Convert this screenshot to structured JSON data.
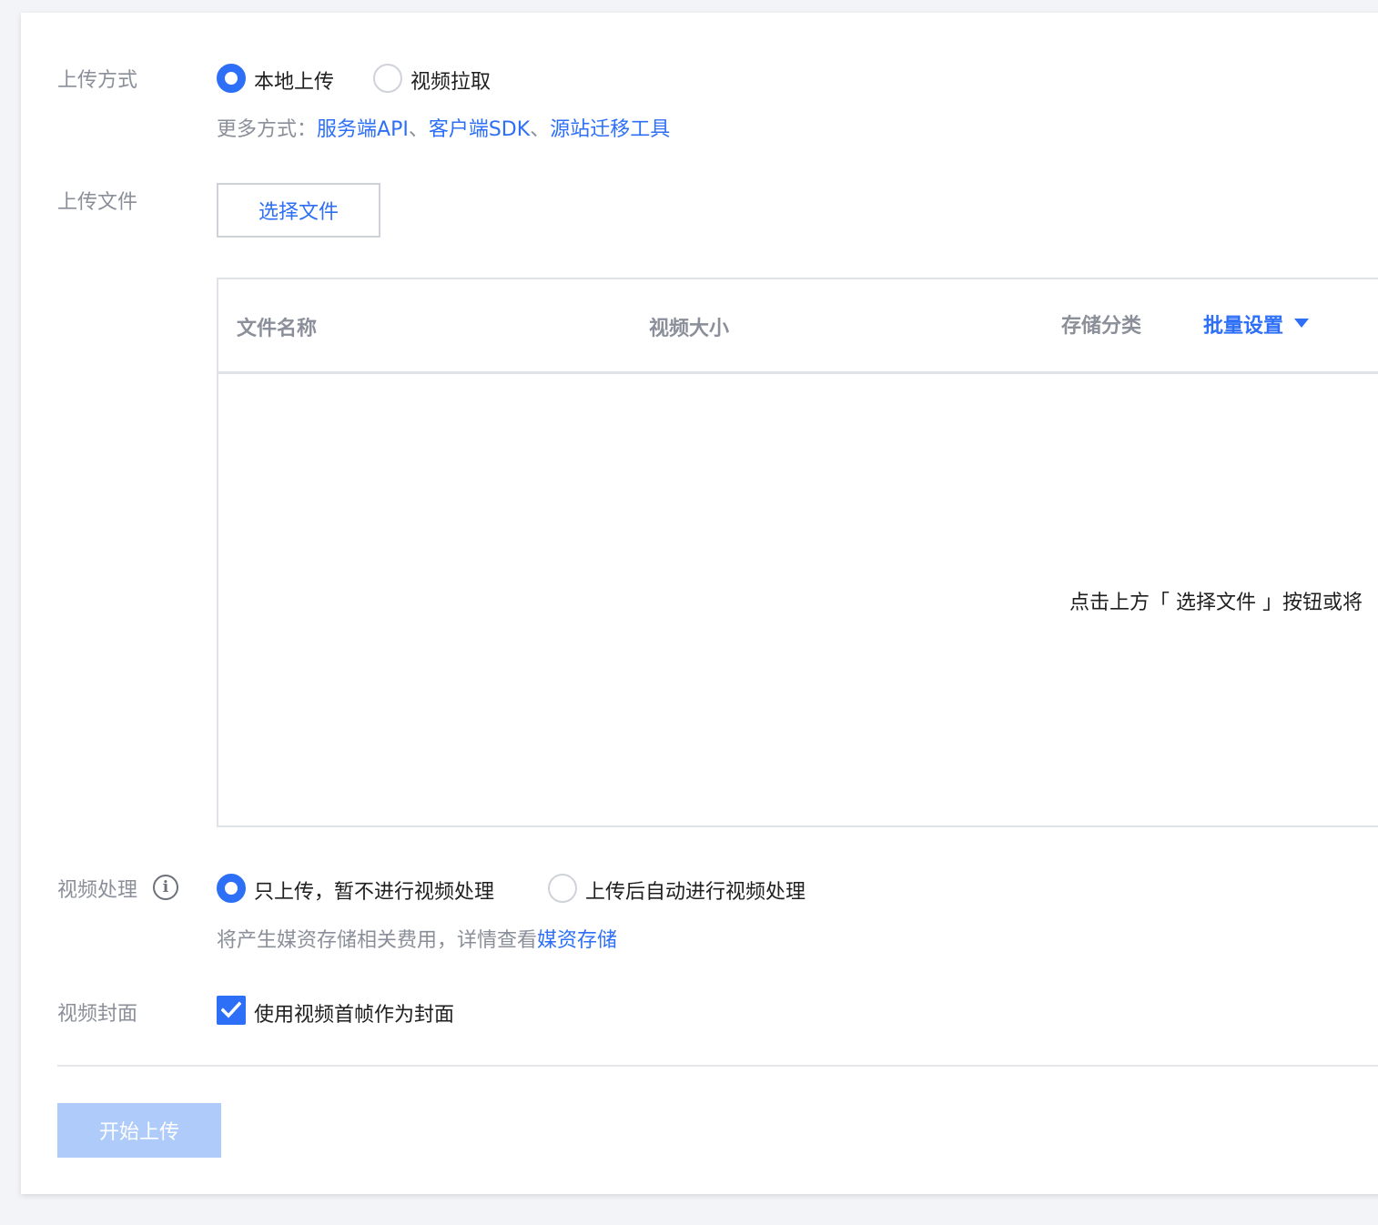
{
  "upload_method": {
    "label": "上传方式",
    "options": [
      {
        "label": "本地上传",
        "selected": true
      },
      {
        "label": "视频拉取",
        "selected": false
      }
    ],
    "more_prefix": "更多方式：",
    "more_links": [
      "服务端API",
      "客户端SDK",
      "源站迁移工具"
    ],
    "separator": "、"
  },
  "upload_file": {
    "label": "上传文件",
    "select_button": "选择文件"
  },
  "file_table": {
    "columns": [
      "文件名称",
      "视频大小",
      "存储分类"
    ],
    "batch_settings": "批量设置",
    "empty_text": "点击上方「 选择文件 」按钮或将"
  },
  "video_processing": {
    "label": "视频处理",
    "options": [
      {
        "label": "只上传，暂不进行视频处理",
        "selected": true
      },
      {
        "label": "上传后自动进行视频处理",
        "selected": false
      }
    ],
    "hint_prefix": "将产生媒资存储相关费用，详情查看",
    "hint_link": "媒资存储"
  },
  "video_cover": {
    "label": "视频封面",
    "checkbox_label": "使用视频首帧作为封面",
    "checked": true
  },
  "start_button": "开始上传",
  "colors": {
    "accent": "#2d6ff7",
    "disabled_button": "#aecbf9",
    "muted_text": "#8a8f99"
  }
}
